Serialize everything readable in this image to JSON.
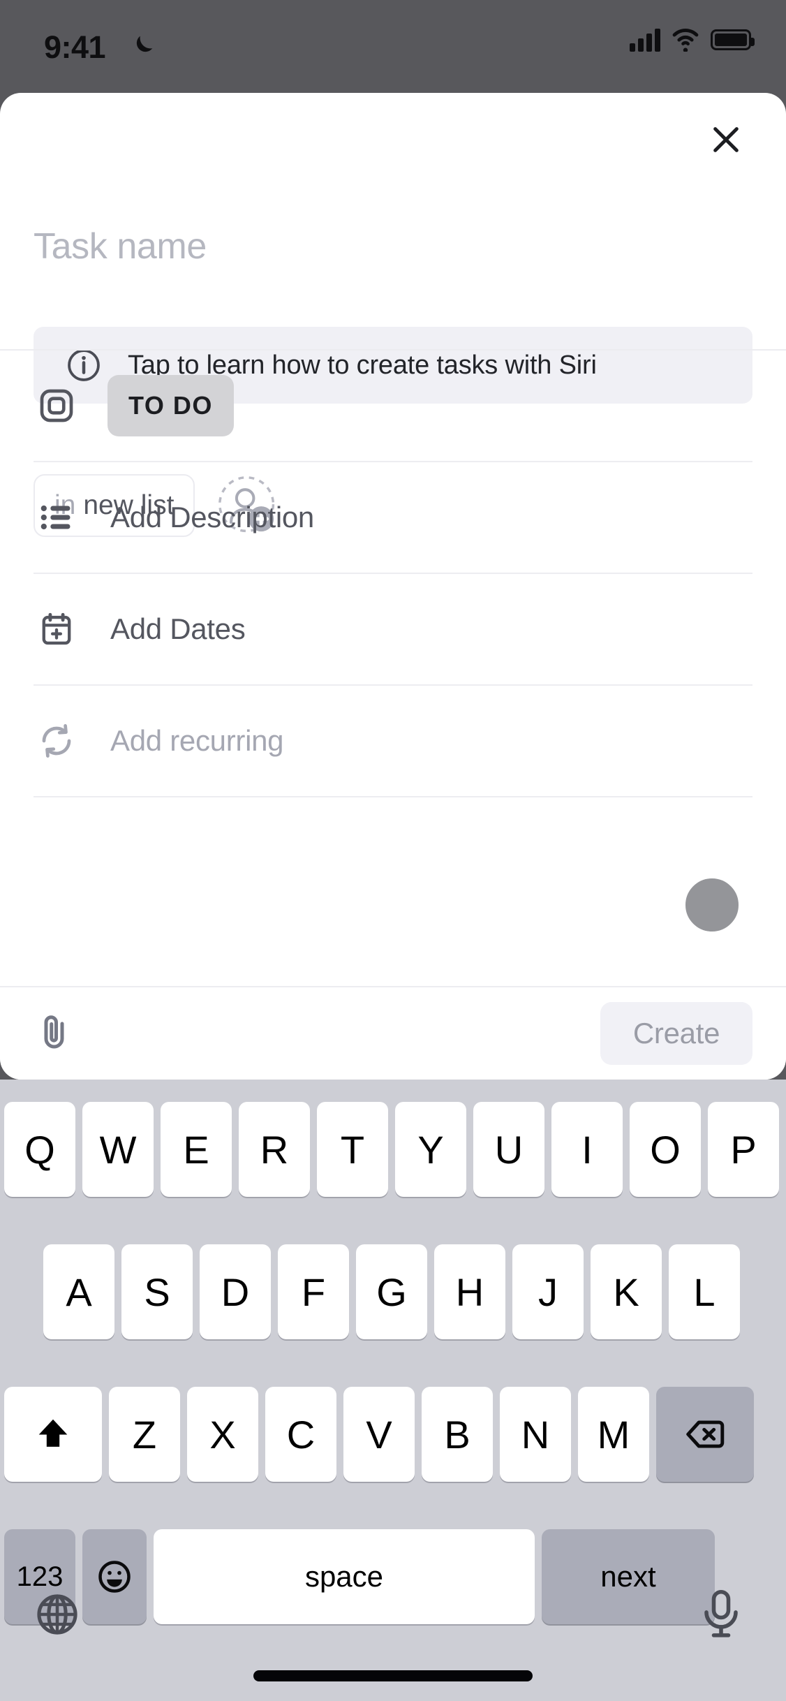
{
  "status_bar": {
    "time": "9:41",
    "dnd_icon": "moon-icon",
    "signal_icon": "cellular-signal-icon",
    "wifi_icon": "wifi-icon",
    "battery_icon": "battery-full-icon"
  },
  "modal": {
    "close_icon": "close-icon",
    "task_name_placeholder": "Task name",
    "siri_banner": {
      "icon": "info-circle-icon",
      "text": "Tap to learn how to create tasks with Siri"
    },
    "list_pill": {
      "prefix": "in",
      "value": "new list"
    },
    "assignee_icon": "add-assignee-icon",
    "rows": [
      {
        "icon": "status-square-icon",
        "badge": "TO DO",
        "type": "badge"
      },
      {
        "icon": "description-list-icon",
        "label": "Add Description",
        "type": "dark"
      },
      {
        "icon": "calendar-plus-icon",
        "label": "Add Dates",
        "type": "dark"
      },
      {
        "icon": "recurring-arrows-icon",
        "label": "Add recurring",
        "type": "light"
      }
    ],
    "toolbar": {
      "attach_icon": "paperclip-icon",
      "create_label": "Create"
    }
  },
  "keyboard": {
    "row1": [
      "Q",
      "W",
      "E",
      "R",
      "T",
      "Y",
      "U",
      "I",
      "O",
      "P"
    ],
    "row2": [
      "A",
      "S",
      "D",
      "F",
      "G",
      "H",
      "J",
      "K",
      "L"
    ],
    "row3": [
      "Z",
      "X",
      "C",
      "V",
      "B",
      "N",
      "M"
    ],
    "shift_icon": "shift-arrow-icon",
    "backspace_icon": "backspace-icon",
    "numbers_key": "123",
    "emoji_icon": "emoji-smiley-icon",
    "space_key": "space",
    "return_key": "next",
    "globe_icon": "globe-icon",
    "mic_icon": "microphone-icon",
    "home_indicator": "home-indicator"
  },
  "overlay": {
    "touch_indicator": "touch-point-indicator"
  },
  "colors": {
    "backdrop": "#58585c",
    "sheet": "#ffffff",
    "banner_bg": "#f0f0f5",
    "badge_bg": "#d3d3d6",
    "keyboard_bg": "#cdced5",
    "key_dark": "#aaacb8",
    "text_dark": "#54565f",
    "text_light": "#a5a7b2"
  }
}
